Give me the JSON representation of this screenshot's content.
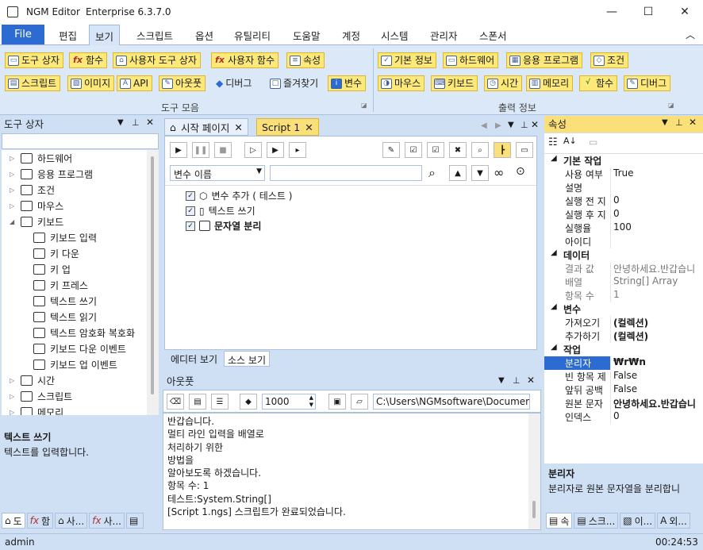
{
  "window": {
    "title": "NGM Editor",
    "edition": "Enterprise 6.3.7.0"
  },
  "menu": {
    "file": "File",
    "items": [
      "편집",
      "보기",
      "스크립트",
      "옵션",
      "유틸리티",
      "도움말",
      "계정",
      "시스템",
      "관리자",
      "스폰서"
    ],
    "active_index": 1
  },
  "ribbon": {
    "group1_label": "도구 모음",
    "group2_label": "출력 정보",
    "row1a": [
      "도구 상자",
      "함수",
      "사용자 도구 상자",
      "사용자 함수",
      "속성"
    ],
    "row2a": [
      "스크립트",
      "이미지",
      "API",
      "아웃풋",
      "디버그",
      "즐겨찾기",
      "변수"
    ],
    "row1b": [
      "기본 정보",
      "하드웨어",
      "응용 프로그램",
      "조건"
    ],
    "row2b": [
      "마우스",
      "키보드",
      "시간",
      "메모리",
      "함수",
      "디버그"
    ]
  },
  "toolbox": {
    "title": "도구 상자",
    "items": [
      {
        "label": "하드웨어",
        "icon": "computer-icon",
        "level": 0,
        "expander": "▷"
      },
      {
        "label": "응용 프로그램",
        "icon": "app-icon",
        "level": 0,
        "expander": "▷"
      },
      {
        "label": "조건",
        "icon": "condition-icon",
        "level": 0,
        "expander": "▷"
      },
      {
        "label": "마우스",
        "icon": "mouse-icon",
        "level": 0,
        "expander": "▷"
      },
      {
        "label": "키보드",
        "icon": "keyboard-icon",
        "level": 0,
        "expander": "◢"
      },
      {
        "label": "키보드 입력",
        "icon": "keyboard-icon",
        "level": 1,
        "expander": ""
      },
      {
        "label": "키 다운",
        "icon": "key-down-icon",
        "level": 1,
        "expander": ""
      },
      {
        "label": "키 업",
        "icon": "key-up-icon",
        "level": 1,
        "expander": ""
      },
      {
        "label": "키 프레스",
        "icon": "key-press-icon",
        "level": 1,
        "expander": ""
      },
      {
        "label": "텍스트 쓰기",
        "icon": "text-write-icon",
        "level": 1,
        "expander": ""
      },
      {
        "label": "텍스트 읽기",
        "icon": "text-read-icon",
        "level": 1,
        "expander": ""
      },
      {
        "label": "텍스트 암호화 복호화",
        "icon": "encrypt-icon",
        "level": 1,
        "expander": ""
      },
      {
        "label": "키보드 다운 이벤트",
        "icon": "lightning-icon",
        "level": 1,
        "expander": ""
      },
      {
        "label": "키보드 업 이벤트",
        "icon": "lightning-icon",
        "level": 1,
        "expander": ""
      },
      {
        "label": "시간",
        "icon": "clock-icon",
        "level": 0,
        "expander": "▷"
      },
      {
        "label": "스크립트",
        "icon": "script-icon",
        "level": 0,
        "expander": "▷"
      },
      {
        "label": "메모리",
        "icon": "memory-icon",
        "level": 0,
        "expander": "▷"
      }
    ],
    "desc_title": "텍스트 쓰기",
    "desc_text": "텍스트를 입력합니다.",
    "bottom_tabs": [
      "도",
      "함",
      "사...",
      "사...",
      ""
    ]
  },
  "editor": {
    "tabs": [
      {
        "label": "시작 페이지",
        "active": false
      },
      {
        "label": "Script 1",
        "active": true
      }
    ],
    "var_dropdown": "변수 이름",
    "search_value": "",
    "script_items": [
      {
        "label": "변수 추가 ( 테스트 )",
        "bold": false
      },
      {
        "label": "텍스트 쓰기",
        "bold": false
      },
      {
        "label": "문자열 분리",
        "bold": true
      }
    ],
    "bottom_tabs": [
      "에디터 보기",
      "소스 보기"
    ]
  },
  "output": {
    "title": "아웃풋",
    "count": "1000",
    "path": "C:\\Users\\NGMsoftware\\Documents\\",
    "lines": [
      "반갑습니다.",
      "멀티 라인 입력을 배열로",
      "처리하기 위한",
      "방법을",
      "알아보도록 하겠습니다.",
      "항목 수: 1",
      "테스트:System.String[]",
      "[Script 1.ngs] 스크립트가 완료되었습니다."
    ]
  },
  "properties": {
    "title": "속성",
    "categories": [
      {
        "name": "기본 작업",
        "rows": [
          [
            "사용 여부",
            "True"
          ],
          [
            "설명",
            ""
          ],
          [
            "실행 전 지",
            "0"
          ],
          [
            "실행 후 지",
            "0"
          ],
          [
            "실행율",
            "100"
          ],
          [
            "아이디",
            ""
          ]
        ]
      },
      {
        "name": "데이터",
        "rows": [
          [
            "결과 값",
            "안녕하세요.반갑습니"
          ],
          [
            "배열",
            "String[] Array"
          ],
          [
            "항목 수",
            "1"
          ]
        ]
      },
      {
        "name": "변수",
        "rows": [
          [
            "가져오기",
            "(컬렉션)"
          ],
          [
            "추가하기",
            "(컬렉션)"
          ]
        ]
      },
      {
        "name": "작업",
        "rows": [
          [
            "분리자",
            "₩r₩n"
          ],
          [
            "빈 항목 제",
            "False"
          ],
          [
            "앞뒤 공백",
            "False"
          ],
          [
            "원본 문자",
            "안녕하세요.반갑습니"
          ],
          [
            "인덱스",
            "0"
          ]
        ]
      }
    ],
    "desc_title": "분리자",
    "desc_text": "분리자로 원본 문자열을 분리합니",
    "bottom_tabs": [
      "속",
      "스크...",
      "이...",
      "외..."
    ]
  },
  "status": {
    "user": "admin",
    "time": "00:24:53"
  },
  "colors": {
    "accent": "#2b6bd2",
    "ribbon_button": "#fde97a",
    "panel_active": "#fbe07a",
    "chrome": "#cfe0f5"
  }
}
